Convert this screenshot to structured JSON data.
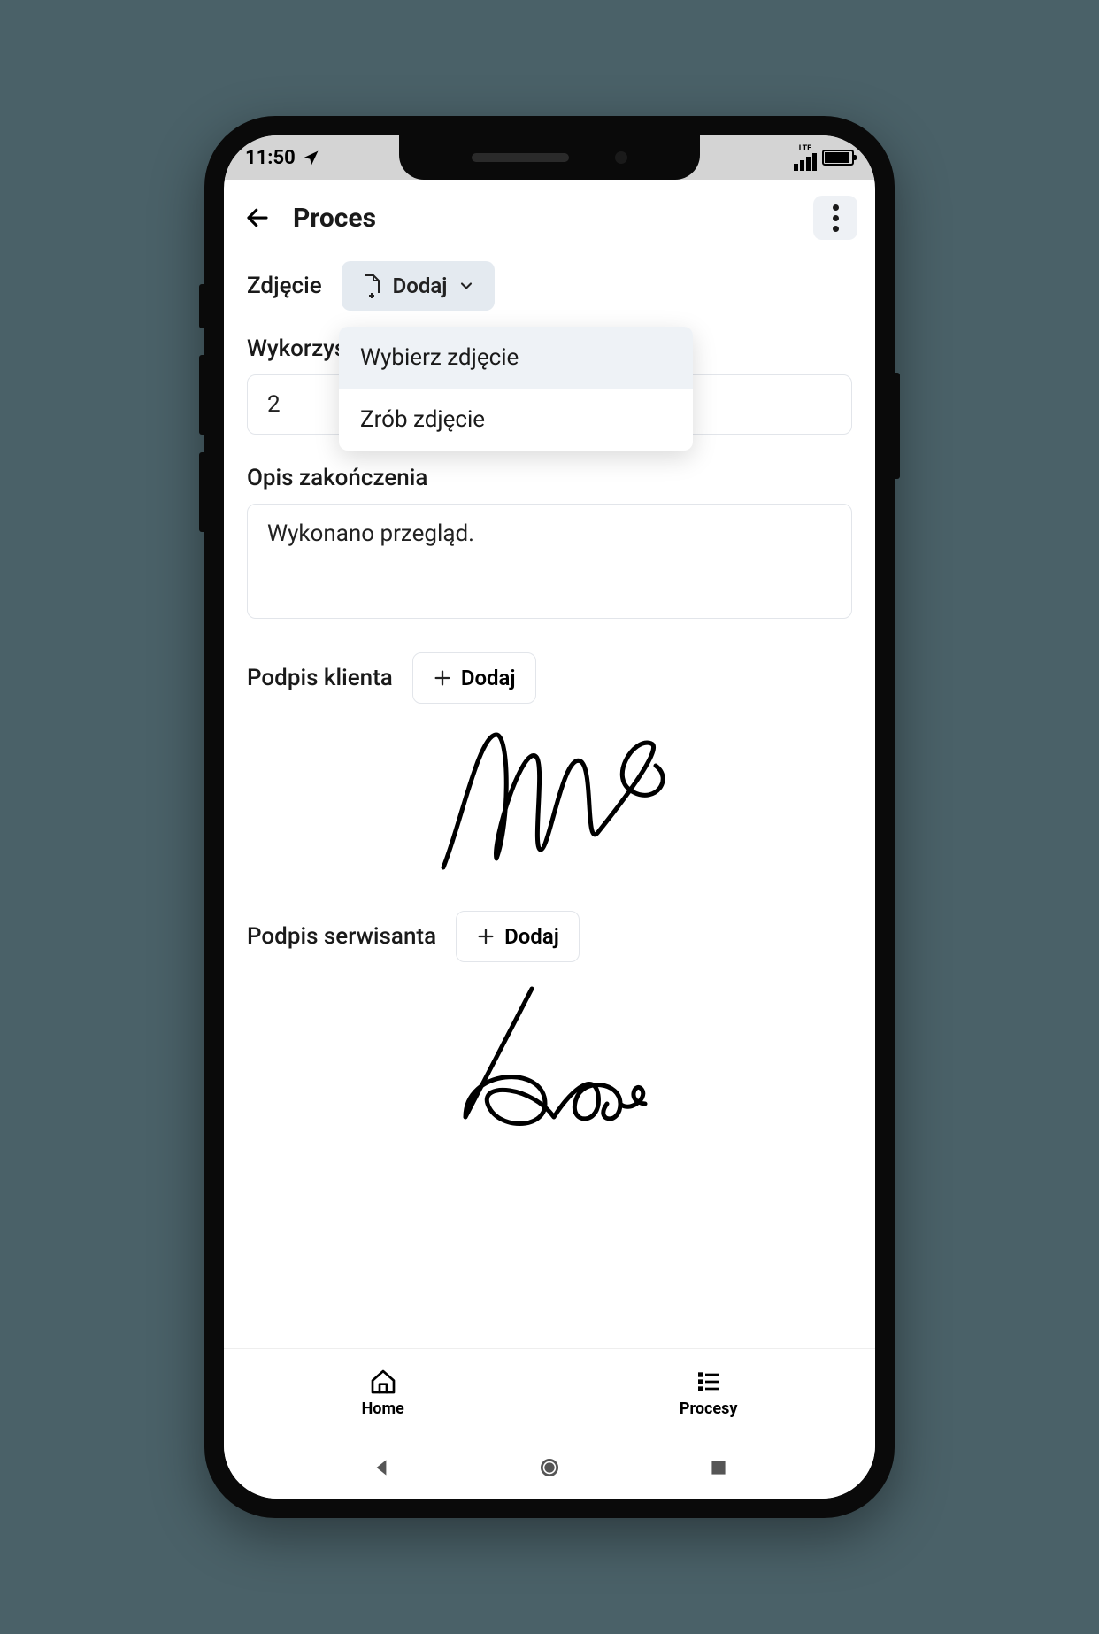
{
  "statusbar": {
    "time": "11:50",
    "network_label": "LTE"
  },
  "header": {
    "title": "Proces"
  },
  "photo": {
    "label": "Zdjęcie",
    "add_label": "Dodaj",
    "menu": {
      "option1": "Wybierz zdjęcie",
      "option2": "Zrób zdjęcie"
    }
  },
  "materials": {
    "label_partial": "Wykorzys",
    "value": "2"
  },
  "description": {
    "label": "Opis zakończenia",
    "value": "Wykonano przegląd."
  },
  "client_signature": {
    "label": "Podpis klienta",
    "add_label": "Dodaj"
  },
  "technician_signature": {
    "label": "Podpis serwisanta",
    "add_label": "Dodaj"
  },
  "bottom_nav": {
    "home": "Home",
    "processes": "Procesy"
  }
}
